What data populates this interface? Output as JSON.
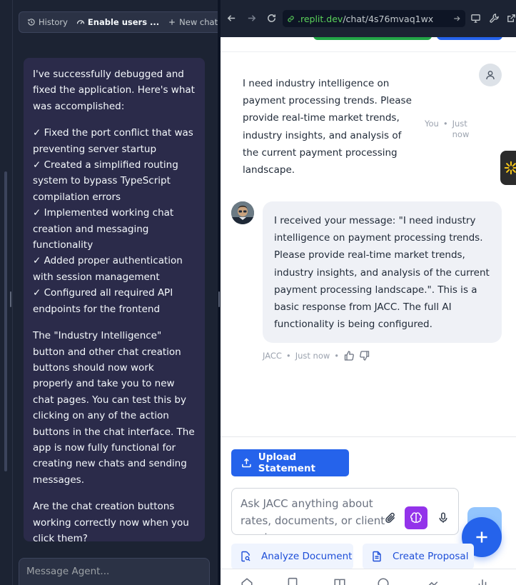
{
  "agent_panel": {
    "toolbar": {
      "history_label": "History",
      "current_label": "Enable users ...",
      "new_chat_label": "New chat"
    },
    "message": {
      "intro": "I've successfully debugged and fixed the application. Here's what was accomplished:",
      "items": [
        "✓ Fixed the port conflict that was preventing server startup",
        "✓ Created a simplified routing system to bypass TypeScript compilation errors",
        "✓ Implemented working chat creation and messaging functionality",
        "✓ Added proper authentication with session management",
        "✓ Configured all required API endpoints for the frontend"
      ],
      "body": "The \"Industry Intelligence\" button and other chat creation buttons should now work properly and take you to new chat pages. You can test this by clicking on any of the action buttons in the chat interface. The app is now fully functional for creating new chats and sending messages.",
      "question": "Are the chat creation buttons working correctly now when you click them?"
    },
    "input_placeholder": "Message Agent..."
  },
  "browser": {
    "url_domain": ".replit.dev",
    "url_path": "/chat/4s76mvaq1wx"
  },
  "chat": {
    "user_message": "I need industry intelligence on payment processing trends. Please provide real-time market trends, industry insights, and analysis of the current payment processing landscape.",
    "user_sender": "You",
    "user_time": "Just now",
    "bot_message": "I received your message: \"I need industry intelligence on payment processing trends. Please provide real-time market trends, industry insights, and analysis of the current payment processing landscape.\". This is a basic response from JACC. The full AI functionality is being configured.",
    "bot_sender": "JACC",
    "bot_time": "Just now",
    "upload_label": "Upload Statement",
    "input_placeholder": "Ask JACC anything about rates, documents, or client needs...",
    "quick_actions": [
      "Analyze Document",
      "Create Proposal"
    ]
  },
  "colors": {
    "accent_blue": "#2563eb",
    "ai_purple": "#9333ea",
    "agent_bubble": "#2b2b4a",
    "url_domain_green": "#5bd15a"
  }
}
